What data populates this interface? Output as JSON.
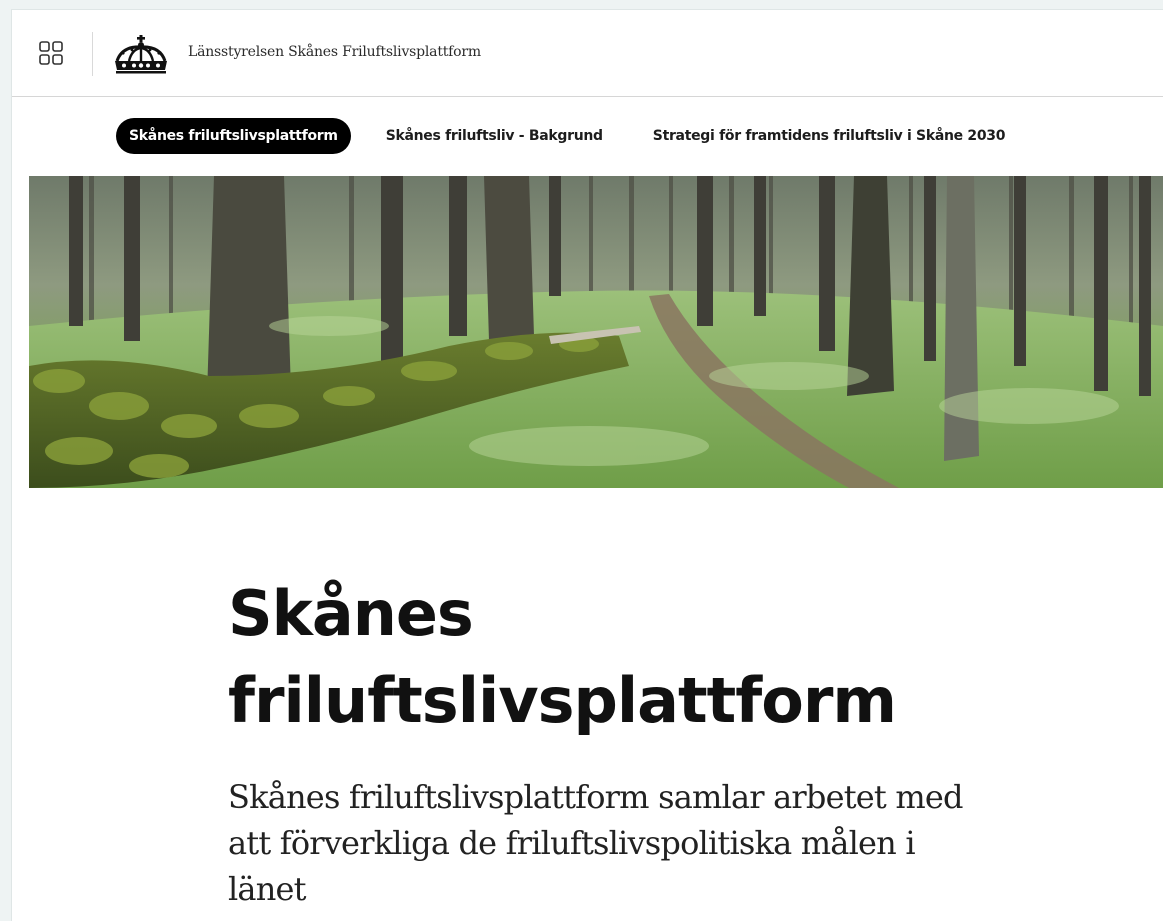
{
  "header": {
    "site_title": "Länsstyrelsen Skånes Friluftslivsplattform",
    "apps_icon": "grid-apps-icon",
    "logo_icon": "royal-crown-icon"
  },
  "nav": {
    "items": [
      {
        "label": "Skånes friluftslivsplattform",
        "active": true
      },
      {
        "label": "Skånes friluftsliv - Bakgrund",
        "active": false
      },
      {
        "label": "Strategi för framtidens friluftsliv i Skåne 2030",
        "active": false
      }
    ]
  },
  "hero": {
    "image": "forest-photo"
  },
  "main": {
    "title_line1": "Skånes",
    "title_line2": "friluftslivsplattform",
    "lead": "Skånes friluftslivsplattform samlar arbetet med att förverkliga de friluftslivspolitiska målen i länet"
  },
  "colors": {
    "accent": "#000000",
    "background": "#ffffff"
  }
}
